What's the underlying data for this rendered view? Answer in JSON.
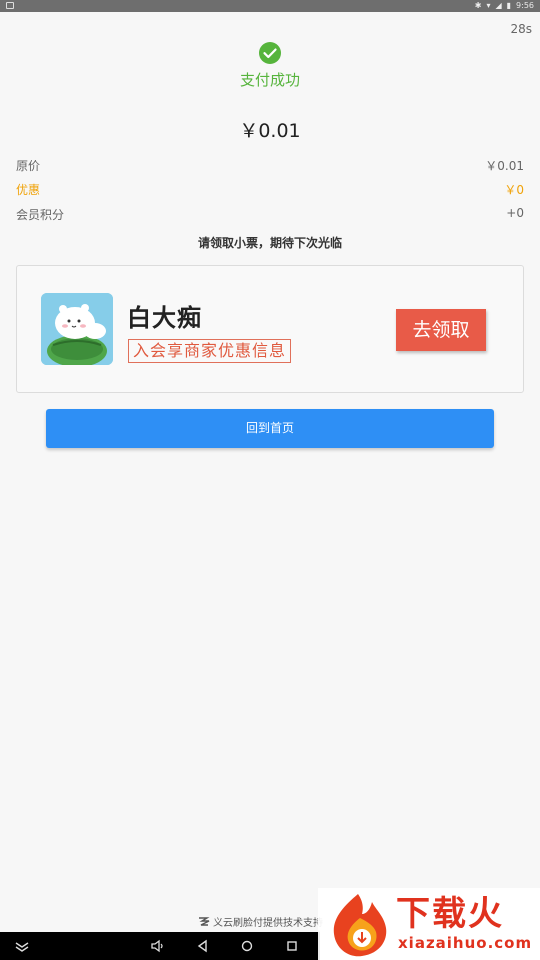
{
  "status_bar": {
    "time": "9:56"
  },
  "countdown": "28s",
  "payment": {
    "status": "支付成功",
    "amount": "￥0.01"
  },
  "breakdown": [
    {
      "label": "原价",
      "value": "￥0.01"
    },
    {
      "label": "优惠",
      "value": "￥0"
    },
    {
      "label": "会员积分",
      "value": "+0"
    }
  ],
  "receipt_tip": "请领取小票，期待下次光临",
  "merchant_card": {
    "name": "白大痴",
    "slogan": "入会享商家优惠信息",
    "claim_label": "去领取"
  },
  "home_button": "回到首页",
  "support_text": "义云刷脸付提供技术支持",
  "watermark": {
    "title": "下载火",
    "domain": "xiazaihuo.com"
  },
  "colors": {
    "success": "#56b43c",
    "discount": "#f0a30a",
    "primary": "#2e8ff5",
    "claim": "#e85b48"
  },
  "icons": [
    "check-circle-icon",
    "notification-icon",
    "bluetooth-icon",
    "wifi-icon",
    "signal-icon",
    "battery-icon",
    "collapse-icon",
    "volume-icon",
    "back-icon",
    "home-icon",
    "recents-icon"
  ]
}
